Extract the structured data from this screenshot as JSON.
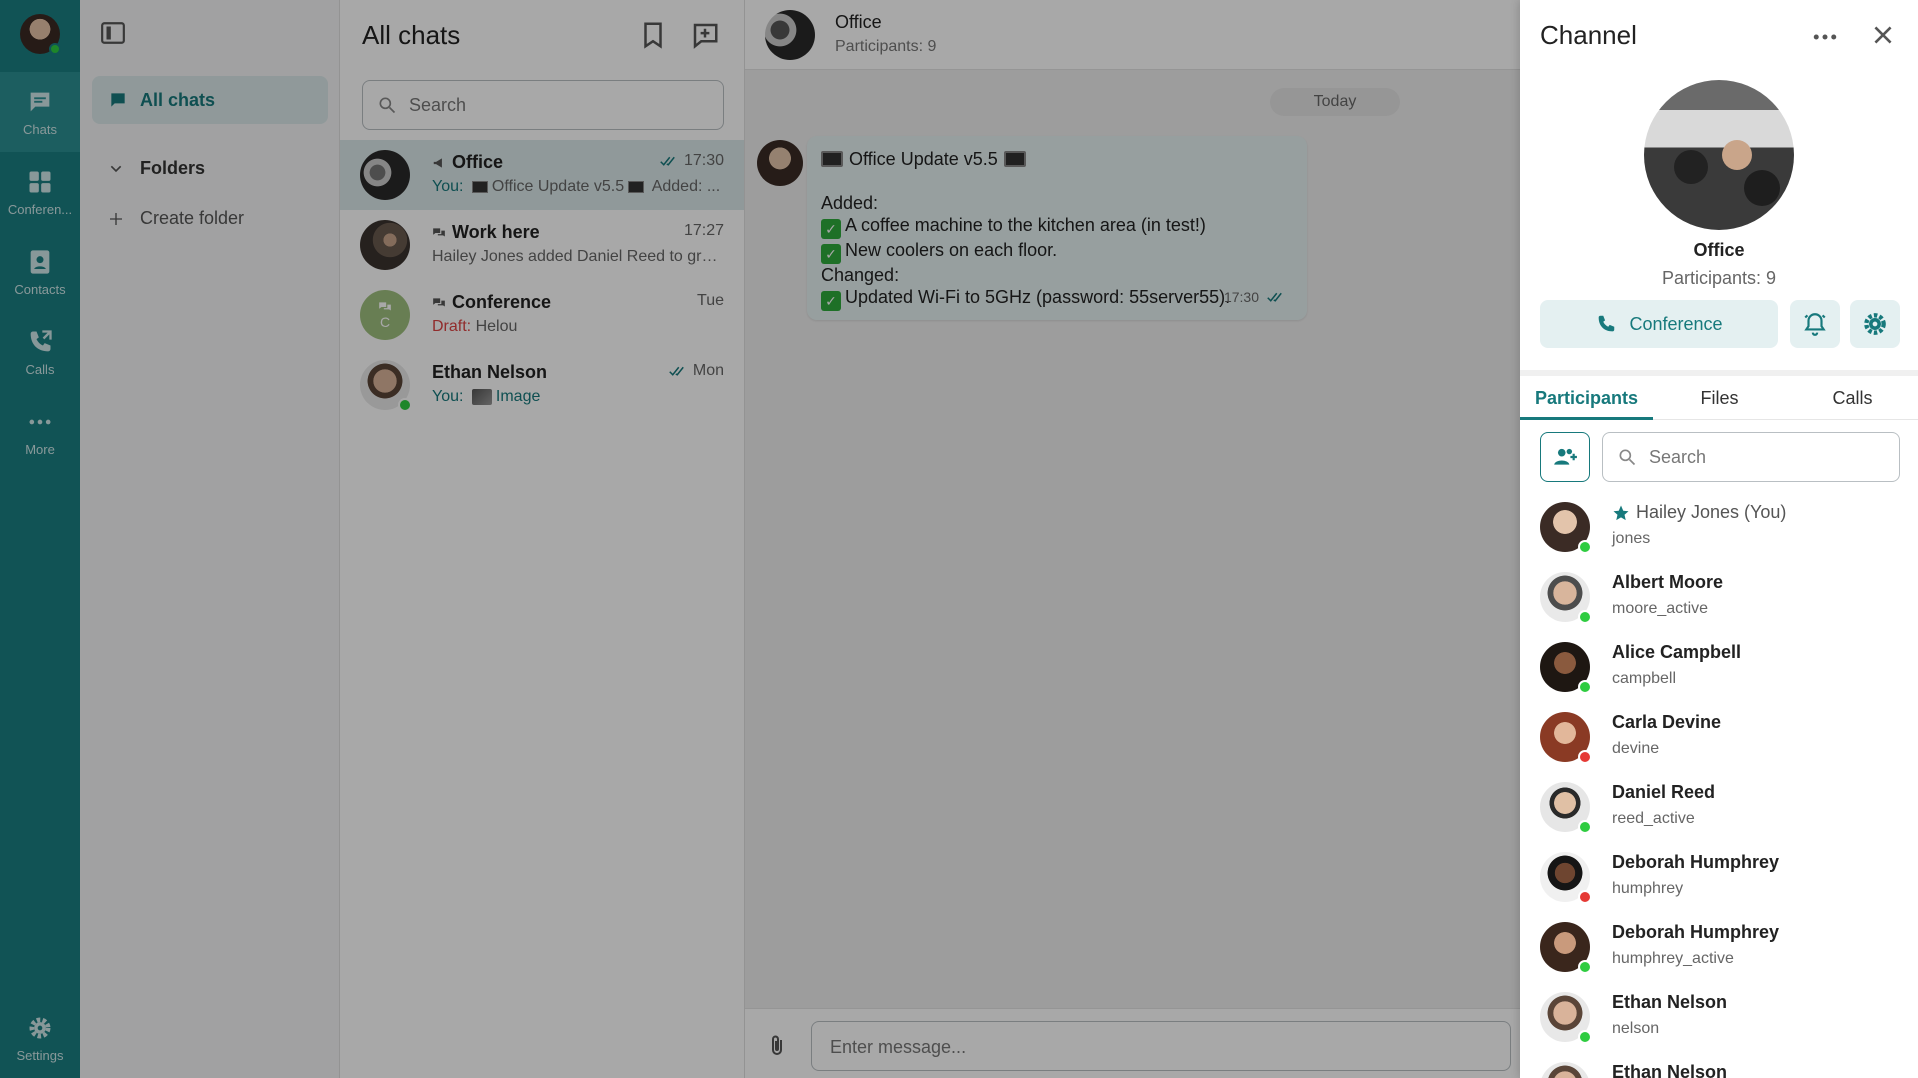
{
  "colors": {
    "accent": "#17797c",
    "rail": "#1a7f82",
    "online": "#2ecc40",
    "busy": "#e53935"
  },
  "rail": {
    "items": [
      {
        "label": "Chats",
        "icon": "chat-icon"
      },
      {
        "label": "Conferen...",
        "icon": "conference-icon"
      },
      {
        "label": "Contacts",
        "icon": "contacts-icon"
      },
      {
        "label": "Calls",
        "icon": "phone-icon"
      },
      {
        "label": "More",
        "icon": "more-icon"
      }
    ],
    "settings_label": "Settings"
  },
  "folders": {
    "all_chats": "All chats",
    "folders_header": "Folders",
    "create_folder": "Create folder"
  },
  "chatlist": {
    "title": "All chats",
    "search_placeholder": "Search",
    "chats": [
      {
        "name": "Office",
        "time": "17:30",
        "prefix": "You:",
        "preview": "Office Update v5.5",
        "preview_tail": "Added: ...",
        "type": "channel"
      },
      {
        "name": "Work here",
        "time": "17:27",
        "preview": "Hailey Jones added Daniel Reed to gro...",
        "type": "group"
      },
      {
        "name": "Conference",
        "time": "Tue",
        "prefix": "Draft:",
        "preview": "Helou",
        "type": "group",
        "avatar_letter": "C"
      },
      {
        "name": "Ethan Nelson",
        "time": "Mon",
        "prefix": "You:",
        "preview": "Image",
        "type": "direct"
      }
    ]
  },
  "conversation": {
    "name": "Office",
    "participants": "Participants: 9",
    "date_pill": "Today",
    "message": {
      "title": "Office Update v5.5",
      "added_label": "Added:",
      "added": [
        "A coffee machine to the kitchen area (in test!)",
        "New coolers on each floor."
      ],
      "changed_label": "Changed:",
      "changed": [
        "Updated Wi-Fi to 5GHz (password: 55server55)."
      ],
      "time": "17:30"
    },
    "input_placeholder": "Enter message..."
  },
  "channel": {
    "title": "Channel",
    "name": "Office",
    "participants": "Participants: 9",
    "conference_button": "Conference",
    "tabs": [
      "Participants",
      "Files",
      "Calls"
    ],
    "search_placeholder": "Search",
    "members": [
      {
        "name": "Hailey Jones (You)",
        "username": "jones",
        "status": "online",
        "starred": true
      },
      {
        "name": "Albert Moore",
        "username": "moore_active",
        "status": "online"
      },
      {
        "name": "Alice Campbell",
        "username": "campbell",
        "status": "online"
      },
      {
        "name": "Carla Devine",
        "username": "devine",
        "status": "busy"
      },
      {
        "name": "Daniel Reed",
        "username": "reed_active",
        "status": "online"
      },
      {
        "name": "Deborah Humphrey",
        "username": "humphrey",
        "status": "busy"
      },
      {
        "name": "Deborah Humphrey",
        "username": "humphrey_active",
        "status": "online"
      },
      {
        "name": "Ethan Nelson",
        "username": "nelson",
        "status": "online"
      },
      {
        "name": "Ethan Nelson",
        "username": "",
        "status": "online"
      }
    ]
  }
}
